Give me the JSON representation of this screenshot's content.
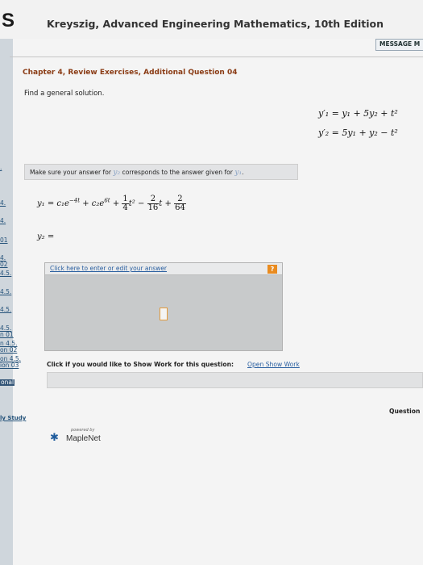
{
  "header": {
    "logo": "S",
    "book_title": "Kreyszig, Advanced Engineering Mathematics, 10th Edition",
    "message_button": "MESSAGE M"
  },
  "nav": {
    "items": [
      ".",
      "4.",
      "4.",
      "01",
      "4.",
      "02",
      "4.5.",
      "4.5.",
      "4.5.",
      "4.5.",
      "n 01",
      "n 4.5.",
      "on 02",
      "on 4.5.",
      "ion 03",
      "onal"
    ],
    "study": "ly Study"
  },
  "question": {
    "title": "Chapter 4, Review Exercises, Additional Question 04",
    "instruction": "Find a general solution.",
    "eq1": "y′₁ = y₁ + 5y₂ + t²",
    "eq2": "y′₂ = 5y₁ + y₂ − t²"
  },
  "note": {
    "text_prefix": "Make sure your answer for",
    "var_y2": "y₂",
    "text_middle": "corresponds to the answer given for",
    "var_y1": "y₁",
    "dot": "."
  },
  "answer": {
    "y1_lhs": "y₁ = c₁e",
    "y1_exp1": "−4t",
    "y1_plus_c2": "+ c₂e",
    "y1_exp2": "6t",
    "frac1_n": "1",
    "frac1_d": "4",
    "t2": "t²",
    "minus": "−",
    "frac2_n": "2",
    "frac2_d": "16",
    "t": "t",
    "plus": "+",
    "frac3_n": "2",
    "frac3_d": "64",
    "y2_lhs": "y₂ ="
  },
  "editor": {
    "link": "Click here to enter or edit your answer",
    "help": "?"
  },
  "show_work": {
    "label": "Click if you would like to Show Work for this question:",
    "link": "Open Show Work"
  },
  "footer": {
    "question_link": "Question",
    "powered_by": "powered by",
    "maplenet": "MapleNet"
  }
}
